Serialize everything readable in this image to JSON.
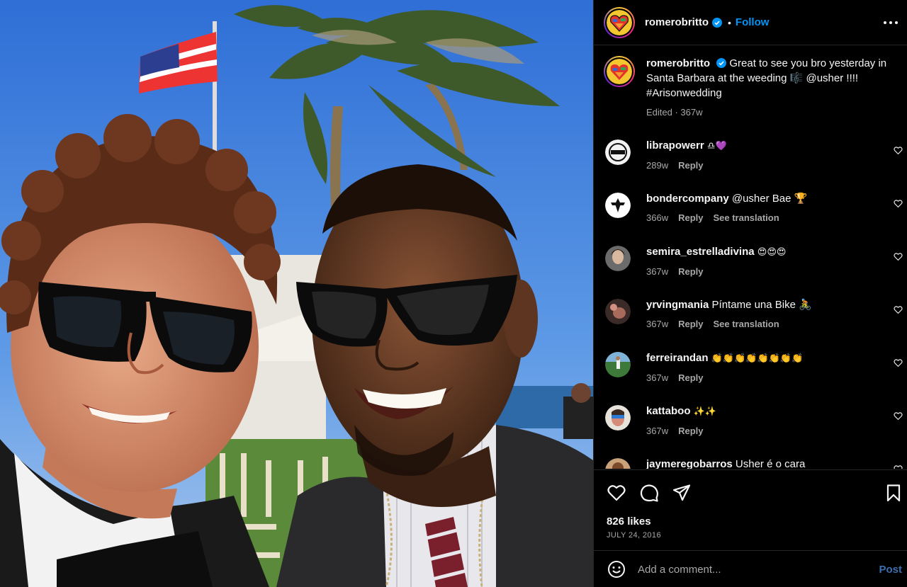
{
  "post": {
    "username": "romerobritto",
    "follow_label": "Follow",
    "dot": "•",
    "caption_username": "romerobritto",
    "caption_text": "Great to see you bro yesterday in Santa Barbara at the weeding 🎼 @usher !!!! #Arisonwedding",
    "caption_meta": "Edited · 367w"
  },
  "comments": [
    {
      "user": "librapowerr",
      "text": "♎💜",
      "time": "289w",
      "reply": "Reply",
      "translation": ""
    },
    {
      "user": "bondercompany",
      "text": "@usher Bae 🏆",
      "time": "366w",
      "reply": "Reply",
      "translation": "See translation"
    },
    {
      "user": "semira_estrelladivina",
      "text": "😍😍😍",
      "time": "367w",
      "reply": "Reply",
      "translation": ""
    },
    {
      "user": "yrvingmania",
      "text": "Píntame una Bike 🚴",
      "time": "367w",
      "reply": "Reply",
      "translation": "See translation"
    },
    {
      "user": "ferreirandan",
      "text": "👏👏👏👏👏👏👏👏",
      "time": "367w",
      "reply": "Reply",
      "translation": ""
    },
    {
      "user": "kattaboo",
      "text": "✨✨",
      "time": "367w",
      "reply": "Reply",
      "translation": ""
    },
    {
      "user": "jaymeregobarros",
      "text": "Usher é o cara",
      "time": "",
      "reply": "",
      "translation": ""
    }
  ],
  "stats": {
    "likes": "826 likes",
    "date": "JULY 24, 2016"
  },
  "composer": {
    "placeholder": "Add a comment...",
    "post_label": "Post"
  },
  "colors": {
    "link": "#0095f6",
    "post_disabled": "#3c6fb0",
    "muted": "#a8a8a8",
    "divider": "#262626"
  },
  "icons": [
    "verified-badge-icon",
    "more-options-icon",
    "heart-icon",
    "comment-icon",
    "share-icon",
    "bookmark-icon",
    "emoji-icon"
  ]
}
